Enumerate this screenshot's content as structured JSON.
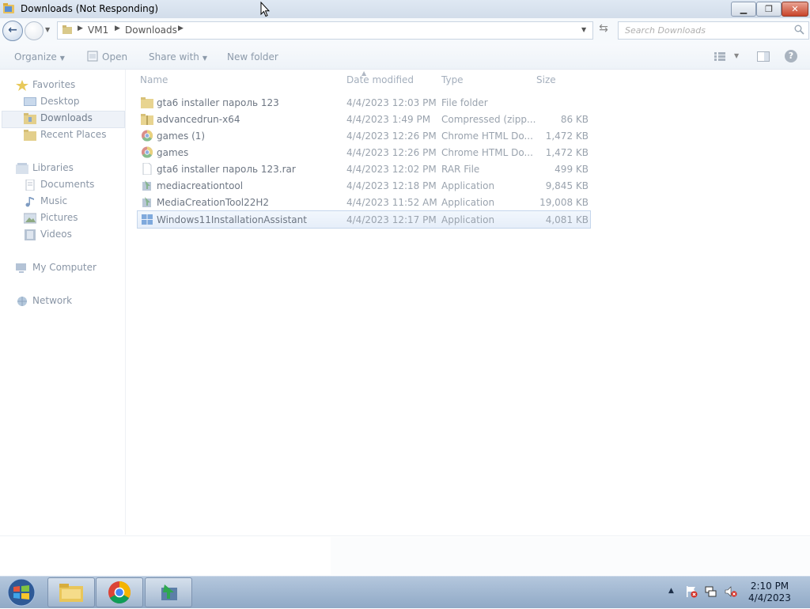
{
  "window": {
    "title": "Downloads (Not Responding)"
  },
  "address": {
    "crumbs": [
      "VM1",
      "Downloads"
    ],
    "search_placeholder": "Search Downloads"
  },
  "toolbar": {
    "organize": "Organize",
    "open": "Open",
    "share_with": "Share with",
    "new_folder": "New folder"
  },
  "nav": {
    "favorites": "Favorites",
    "desktop": "Desktop",
    "downloads": "Downloads",
    "recent_places": "Recent Places",
    "libraries": "Libraries",
    "documents": "Documents",
    "music": "Music",
    "pictures": "Pictures",
    "videos": "Videos",
    "my_computer": "My Computer",
    "network": "Network"
  },
  "columns": {
    "name": "Name",
    "date": "Date modified",
    "type": "Type",
    "size": "Size"
  },
  "files": [
    {
      "name": "gta6 installer пароль 123",
      "date": "4/4/2023 12:03 PM",
      "type": "File folder",
      "size": "",
      "icon": "folder-icon"
    },
    {
      "name": "advancedrun-x64",
      "date": "4/4/2023 1:49 PM",
      "type": "Compressed (zipp...",
      "size": "86 KB",
      "icon": "zip-folder-icon"
    },
    {
      "name": "games (1)",
      "date": "4/4/2023 12:26 PM",
      "type": "Chrome HTML Do...",
      "size": "1,472 KB",
      "icon": "chrome-icon"
    },
    {
      "name": "games",
      "date": "4/4/2023 12:26 PM",
      "type": "Chrome HTML Do...",
      "size": "1,472 KB",
      "icon": "chrome-icon"
    },
    {
      "name": "gta6 installer пароль 123.rar",
      "date": "4/4/2023 12:02 PM",
      "type": "RAR File",
      "size": "499 KB",
      "icon": "file-icon"
    },
    {
      "name": "mediacreationtool",
      "date": "4/4/2023 12:18 PM",
      "type": "Application",
      "size": "9,845 KB",
      "icon": "installer-icon"
    },
    {
      "name": "MediaCreationTool22H2",
      "date": "4/4/2023 11:52 AM",
      "type": "Application",
      "size": "19,008 KB",
      "icon": "installer-icon"
    },
    {
      "name": "Windows11InstallationAssistant",
      "date": "4/4/2023 12:17 PM",
      "type": "Application",
      "size": "4,081 KB",
      "icon": "windows-logo-icon"
    }
  ],
  "selected_index": 7,
  "clock": {
    "time": "2:10 PM",
    "date": "4/4/2023"
  }
}
